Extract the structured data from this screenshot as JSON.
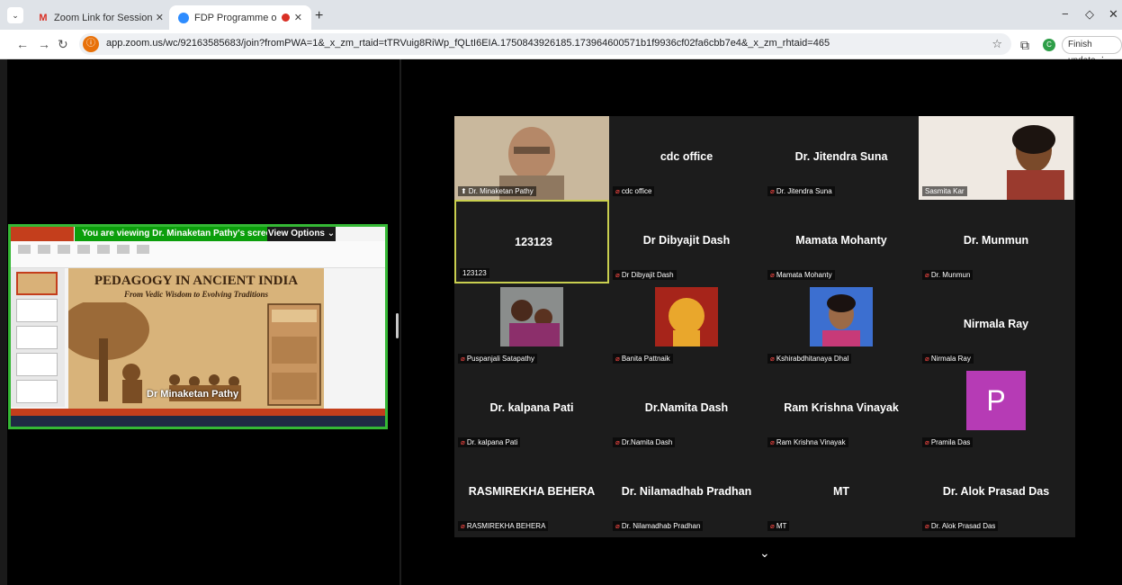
{
  "browser": {
    "tabs": [
      {
        "title": "Zoom Link for Session starting",
        "icon": "gmail-icon"
      },
      {
        "title": "FDP Programme on \"Integr",
        "icon": "zoom-icon"
      }
    ],
    "url": "app.zoom.us/wc/92163585683/join?fromPWA=1&_x_zm_rtaid=tTRVuig8RiWp_fQLtI6EIA.1750843926185.173964600571b1f9936cf02fa6cbb7e4&_x_zm_rhtaid=465",
    "update_label": "Finish update",
    "profile_initial": "C"
  },
  "share": {
    "banner_text": "You are viewing  Dr. Minaketan Pathy's screen",
    "view_options": "View Options",
    "slide_title": "PEDAGOGY IN ANCIENT INDIA",
    "slide_subtitle": "From Vedic Wisdom to Evolving Traditions",
    "presenter_label": "Dr Minaketan Pathy",
    "accent_color": "#35b835"
  },
  "gallery": {
    "tiles": [
      {
        "display": "",
        "label": "Dr. Minaketan Pathy",
        "muted": false,
        "video": "elderly-man"
      },
      {
        "display": "cdc office",
        "label": "cdc office",
        "muted": true
      },
      {
        "display": "Dr. Jitendra Suna",
        "label": "Dr. Jitendra Suna",
        "muted": true
      },
      {
        "display": "",
        "label": "Sasmita Kar",
        "muted": false,
        "video": "woman-speaking"
      },
      {
        "display": "123123",
        "label": "123123",
        "muted": false,
        "active": true
      },
      {
        "display": "Dr Dibyajit Dash",
        "label": "Dr Dibyajit Dash",
        "muted": true
      },
      {
        "display": "Mamata Mohanty",
        "label": "Mamata Mohanty",
        "muted": true
      },
      {
        "display": "Dr. Munmun",
        "label": "Dr. Munmun",
        "muted": true
      },
      {
        "display": "",
        "label": "Puspanjali Satapathy",
        "muted": true,
        "photo": "family-photo"
      },
      {
        "display": "",
        "label": "Banita Pattnaik",
        "muted": true,
        "photo": "ganesha-photo"
      },
      {
        "display": "",
        "label": "Kshirabdhitanaya Dhal",
        "muted": true,
        "photo": "woman-photo"
      },
      {
        "display": "Nirmala Ray",
        "label": "Nirmala Ray",
        "muted": true
      },
      {
        "display": "Dr. kalpana Pati",
        "label": "Dr. kalpana Pati",
        "muted": true
      },
      {
        "display": "Dr.Namita Dash",
        "label": "Dr.Namita Dash",
        "muted": true
      },
      {
        "display": "Ram Krishna Vinayak",
        "label": "Ram Krishna Vinayak",
        "muted": true
      },
      {
        "display": "",
        "label": "Pramila Das",
        "muted": true,
        "avatar": "P"
      },
      {
        "display": "RASMIREKHA BEHERA",
        "label": "RASMIREKHA BEHERA",
        "muted": true
      },
      {
        "display": "Dr. Nilamadhab Pradhan",
        "label": "Dr. Nilamadhab Pradhan",
        "muted": true
      },
      {
        "display": "MT",
        "label": "MT",
        "muted": true
      },
      {
        "display": "Dr. Alok Prasad Das",
        "label": "Dr. Alok Prasad Das",
        "muted": true
      }
    ],
    "pramila_avatar_color": "#b63bb5",
    "active_border_color": "#c9cf4f"
  }
}
